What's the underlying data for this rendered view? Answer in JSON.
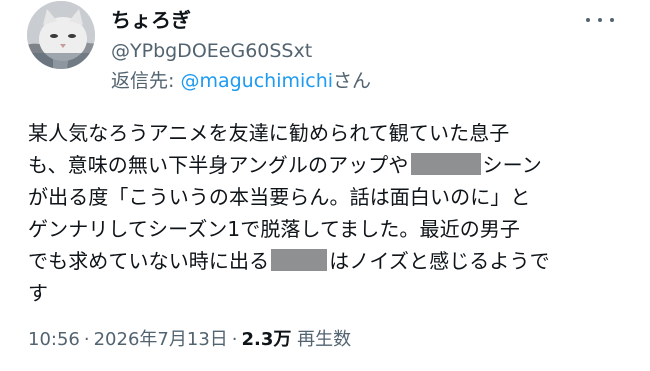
{
  "author": {
    "display_name": "ちょろぎ",
    "handle": "@YPbgDOEeG60SSxt"
  },
  "reply_to": {
    "prefix": "返信先: ",
    "mention": "@maguchimichi",
    "suffix": "さん"
  },
  "tweet": {
    "line1": "某人気なろうアニメを友達に勧められて観ていた息子",
    "line2_a": "も、意味の無い下半身アングルのアップや",
    "line2_b": "シーン",
    "line3": "が出る度「こういうの本当要らん。話は面白いのに」と",
    "line4": "ゲンナリしてシーズン1で脱落してました。最近の男子",
    "line5_a": "でも求めていない時に出る",
    "line5_b": "はノイズと感じるようで",
    "line6": "す"
  },
  "meta": {
    "time": "10:56",
    "separator": "·",
    "date": "2026年7月13日",
    "views_count": "2.3万",
    "views_label": " 再生数"
  },
  "icons": {
    "avatar": "cat-avatar-icon",
    "more": "more-options-icon"
  },
  "colors": {
    "primary_text": "#0f1419",
    "secondary_text": "#536471",
    "mention": "#1d9bf0",
    "censor": "#8e9092"
  }
}
